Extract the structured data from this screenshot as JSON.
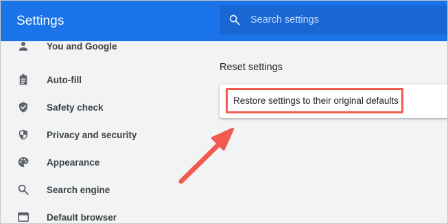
{
  "app": {
    "title": "Settings"
  },
  "search": {
    "placeholder": "Search settings",
    "icon": "search-icon"
  },
  "sidebar": {
    "items": [
      {
        "label": "You and Google",
        "icon": "person-icon"
      },
      {
        "label": "Auto-fill",
        "icon": "clipboard-icon"
      },
      {
        "label": "Safety check",
        "icon": "shield-check-icon"
      },
      {
        "label": "Privacy and security",
        "icon": "shield-half-icon"
      },
      {
        "label": "Appearance",
        "icon": "palette-icon"
      },
      {
        "label": "Search engine",
        "icon": "magnifier-icon"
      },
      {
        "label": "Default browser",
        "icon": "browser-window-icon"
      }
    ]
  },
  "main": {
    "section_title": "Reset settings",
    "restore_label": "Restore settings to their original defaults"
  },
  "colors": {
    "header": "#1a73e8",
    "search_field": "#1967d2",
    "annotation": "#f25a50",
    "page_bg": "#f1f3f4",
    "nav_icon": "#5f6368"
  }
}
